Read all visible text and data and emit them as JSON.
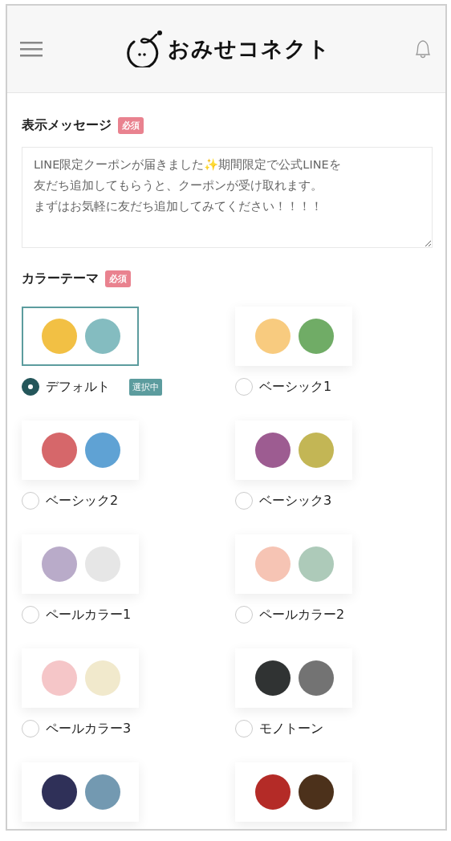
{
  "header": {
    "app_name": "おみせコネクト"
  },
  "message": {
    "label": "表示メッセージ",
    "badge": "必須",
    "lines": [
      "LINE限定クーポンが届きました✨期間限定で公式LINEを",
      "友だち追加してもらうと、クーポンが受け取れます。",
      "まずはお気軽に友だち追加してみてください！！！！"
    ]
  },
  "color_theme": {
    "label": "カラーテーマ",
    "badge": "必須",
    "selected_badge": "選択中",
    "themes": [
      {
        "name": "デフォルト",
        "selected": true,
        "swatches": [
          {
            "color": "#f2c044"
          },
          {
            "color": "#84bcc0"
          }
        ]
      },
      {
        "name": "ベーシック1",
        "selected": false,
        "swatches": [
          {
            "color": "#f8cb7f"
          },
          {
            "color": "#70ac66"
          }
        ]
      },
      {
        "name": "ベーシック2",
        "selected": false,
        "swatches": [
          {
            "color": "#d6676a"
          },
          {
            "color": "#5fa2d4"
          }
        ]
      },
      {
        "name": "ベーシック3",
        "selected": false,
        "swatches": [
          {
            "color": "#9d5c91"
          },
          {
            "color": "#c3b655"
          }
        ]
      },
      {
        "name": "ペールカラー1",
        "selected": false,
        "swatches": [
          {
            "color": "#b9abc9"
          },
          {
            "color": "#e6e6e6"
          }
        ]
      },
      {
        "name": "ペールカラー2",
        "selected": false,
        "swatches": [
          {
            "color": "#f6c4b4"
          },
          {
            "color": "#adcab9"
          }
        ]
      },
      {
        "name": "ペールカラー3",
        "selected": false,
        "swatches": [
          {
            "color": "#f5c6c8"
          },
          {
            "color": "#f1e9cc"
          }
        ]
      },
      {
        "name": "モノトーン",
        "selected": false,
        "swatches": [
          {
            "color": "#303333"
          },
          {
            "color": "#737373"
          }
        ]
      },
      {
        "selected": false,
        "swatches": [
          {
            "color": "#2f3058"
          },
          {
            "color": "#7399b1"
          }
        ]
      },
      {
        "selected": false,
        "swatches": [
          {
            "color": "#b42b27"
          },
          {
            "color": "#4c311b"
          }
        ]
      }
    ]
  }
}
